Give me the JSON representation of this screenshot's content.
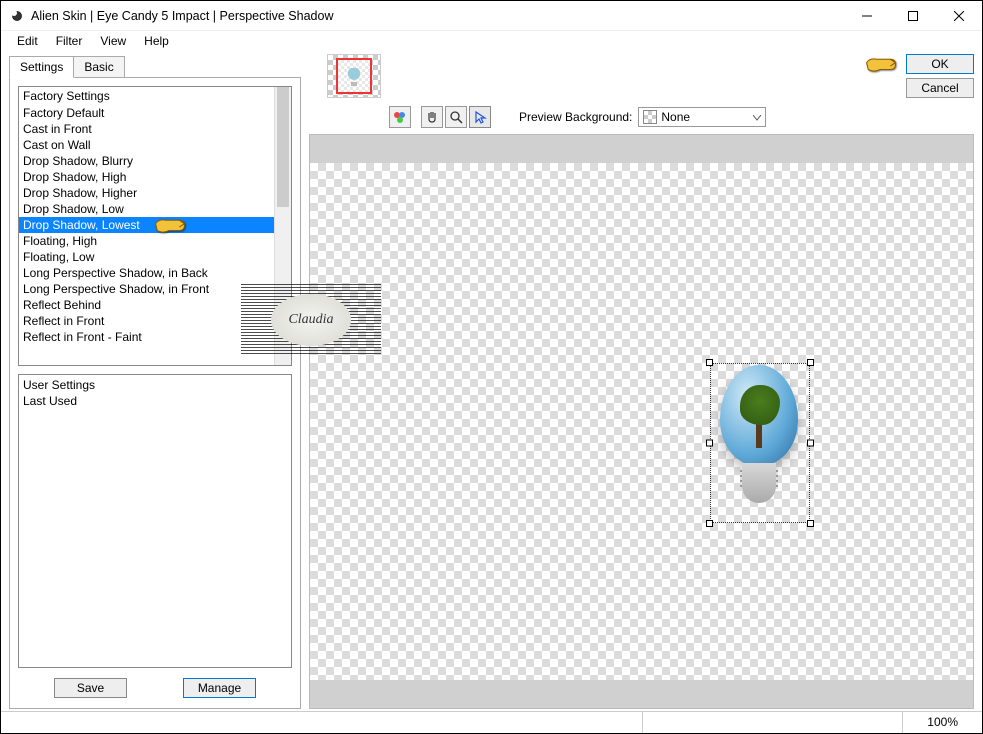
{
  "window": {
    "title": "Alien Skin | Eye Candy 5 Impact | Perspective Shadow"
  },
  "menu": {
    "edit": "Edit",
    "filter": "Filter",
    "view": "View",
    "help": "Help"
  },
  "tabs": {
    "settings": "Settings",
    "basic": "Basic"
  },
  "factory": {
    "header": "Factory Settings",
    "items": [
      "Factory Default",
      "Cast in Front",
      "Cast on Wall",
      "Drop Shadow, Blurry",
      "Drop Shadow, High",
      "Drop Shadow, Higher",
      "Drop Shadow, Low",
      "Drop Shadow, Lowest",
      "Floating, High",
      "Floating, Low",
      "Long Perspective Shadow, in Back",
      "Long Perspective Shadow, in Front",
      "Reflect Behind",
      "Reflect in Front",
      "Reflect in Front - Faint"
    ],
    "selected_index": 7
  },
  "user": {
    "header": "User Settings",
    "last_used": "Last Used"
  },
  "buttons": {
    "save": "Save",
    "manage": "Manage",
    "ok": "OK",
    "cancel": "Cancel"
  },
  "preview": {
    "bg_label": "Preview Background:",
    "bg_value": "None"
  },
  "watermark": {
    "text": "Claudia"
  },
  "status": {
    "zoom": "100%"
  }
}
